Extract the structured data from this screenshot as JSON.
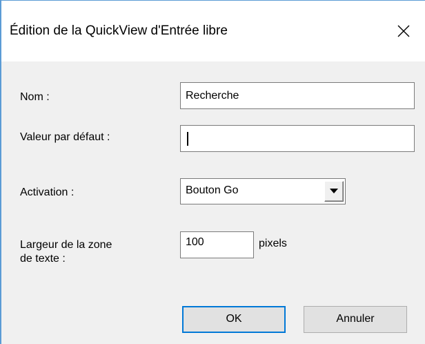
{
  "dialog": {
    "title": "Édition de la QuickView d'Entrée libre",
    "close_icon": "close-icon"
  },
  "form": {
    "name": {
      "label": "Nom :",
      "value": "Recherche"
    },
    "default_value": {
      "label": "Valeur par défaut :",
      "value": ""
    },
    "activation": {
      "label": "Activation :",
      "selected": "Bouton Go",
      "dropdown_icon": "chevron-down-icon"
    },
    "width": {
      "label_line1": "Largeur de la zone",
      "label_line2": "de texte :",
      "value": "100",
      "unit": "pixels"
    }
  },
  "buttons": {
    "ok_label": "OK",
    "cancel_label": "Annuler"
  },
  "colors": {
    "accent": "#0078d7",
    "window_border": "#5b9bd5",
    "dialog_bg": "#f0f0f0"
  }
}
